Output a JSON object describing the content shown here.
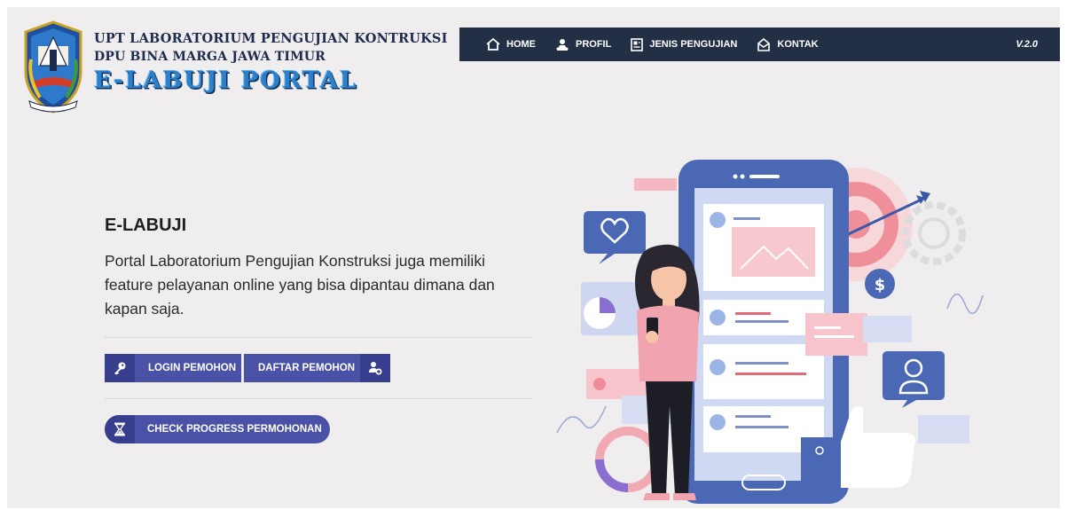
{
  "header": {
    "org_line1": "UPT LABORATORIUM PENGUJIAN KONTRUKSI",
    "org_line2": "DPU BINA MARGA JAWA TIMUR",
    "portal_name": "E-LABUJI PORTAL",
    "logo_icon": "jawa-timur-crest-icon"
  },
  "nav": {
    "items": [
      {
        "label": "HOME",
        "icon": "home-icon"
      },
      {
        "label": "PROFIL",
        "icon": "profile-icon"
      },
      {
        "label": "JENIS PENGUJIAN",
        "icon": "document-icon"
      },
      {
        "label": "KONTAK",
        "icon": "contact-icon"
      }
    ],
    "version": "V.2.0"
  },
  "hero": {
    "title": "E-LABUJI",
    "description": "Portal Laboratorium Pengujian Konstruksi juga memiliki feature pelayanan online yang bisa dipantau dimana dan kapan saja."
  },
  "buttons": {
    "login": {
      "label": "LOGIN PEMOHON",
      "icon": "key-icon"
    },
    "daftar": {
      "label": "DAFTAR PEMOHON",
      "icon": "add-user-icon"
    },
    "check": {
      "label": "CHECK PROGRESS PERMOHONAN",
      "icon": "hourglass-icon"
    }
  },
  "colors": {
    "navbar": "#232f45",
    "button": "#4a52a7",
    "button_icon_bg": "#363e8d",
    "background": "#efeded"
  }
}
